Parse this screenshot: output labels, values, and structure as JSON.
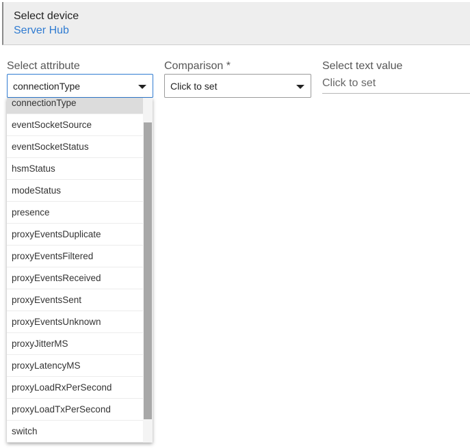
{
  "device": {
    "label": "Select device",
    "value": "Server Hub"
  },
  "attribute": {
    "label": "Select attribute",
    "selected": "connectionType",
    "options": [
      "connectionType",
      "eventSocketSource",
      "eventSocketStatus",
      "hsmStatus",
      "modeStatus",
      "presence",
      "proxyEventsDuplicate",
      "proxyEventsFiltered",
      "proxyEventsReceived",
      "proxyEventsSent",
      "proxyEventsUnknown",
      "proxyJitterMS",
      "proxyLatencyMS",
      "proxyLoadRxPerSecond",
      "proxyLoadTxPerSecond",
      "switch"
    ]
  },
  "comparison": {
    "label": "Comparison *",
    "value": "Click to set"
  },
  "text_value": {
    "label": "Select text value",
    "placeholder": "Click to set"
  },
  "colors": {
    "accent": "#2f7bd1",
    "header_bg": "#eeeeee",
    "selected_bg": "#dcdcdc",
    "scroll_thumb": "#a8a8a8"
  }
}
